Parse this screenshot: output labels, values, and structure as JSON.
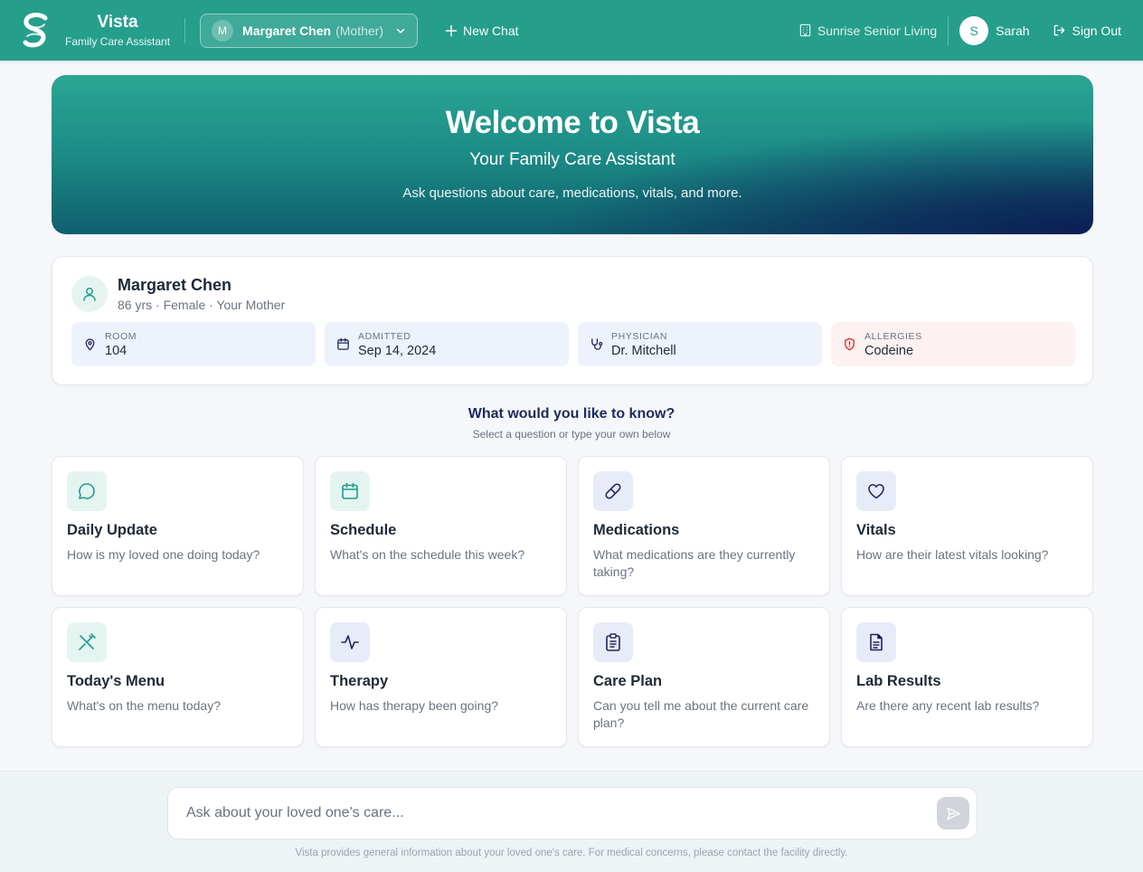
{
  "header": {
    "brand_name": "Vista",
    "brand_sub": "Family Care Assistant",
    "resident_initial": "M",
    "resident_name": "Margaret Chen",
    "resident_relation": "(Mother)",
    "new_chat_label": "New Chat",
    "facility": "Sunrise Senior Living",
    "user_initial": "S",
    "user_name": "Sarah",
    "sign_out_label": "Sign Out"
  },
  "hero": {
    "title": "Welcome to Vista",
    "subtitle": "Your Family Care Assistant",
    "tagline": "Ask questions about care, medications, vitals, and more."
  },
  "profile": {
    "name": "Margaret Chen",
    "meta": "86 yrs · Female · Your Mother",
    "stats": [
      {
        "label": "ROOM",
        "value": "104",
        "icon": "map-pin-icon"
      },
      {
        "label": "ADMITTED",
        "value": "Sep 14, 2024",
        "icon": "calendar-icon"
      },
      {
        "label": "PHYSICIAN",
        "value": "Dr. Mitchell",
        "icon": "stethoscope-icon"
      },
      {
        "label": "ALLERGIES",
        "value": "Codeine",
        "icon": "shield-alert-icon"
      }
    ]
  },
  "prompt": {
    "heading": "What would you like to know?",
    "sub": "Select a question or type your own below"
  },
  "cards": [
    {
      "title": "Daily Update",
      "desc": "How is my loved one doing today?",
      "icon": "chat-bubble-icon"
    },
    {
      "title": "Schedule",
      "desc": "What's on the schedule this week?",
      "icon": "calendar-icon"
    },
    {
      "title": "Medications",
      "desc": "What medications are they currently taking?",
      "icon": "pill-icon"
    },
    {
      "title": "Vitals",
      "desc": "How are their latest vitals looking?",
      "icon": "heart-icon"
    },
    {
      "title": "Today's Menu",
      "desc": "What's on the menu today?",
      "icon": "utensils-icon"
    },
    {
      "title": "Therapy",
      "desc": "How has therapy been going?",
      "icon": "activity-icon"
    },
    {
      "title": "Care Plan",
      "desc": "Can you tell me about the current care plan?",
      "icon": "clipboard-icon"
    },
    {
      "title": "Lab Results",
      "desc": "Are there any recent lab results?",
      "icon": "document-icon"
    }
  ],
  "chat": {
    "placeholder": "Ask about your loved one's care...",
    "disclaimer": "Vista provides general information about your loved one's care. For medical concerns, please contact the facility directly."
  },
  "colors": {
    "header_bg": "#259e8c",
    "teal_accent": "#1f9d8b",
    "indigo_accent": "#1e2a5e",
    "allergy_red": "#dc2626"
  }
}
